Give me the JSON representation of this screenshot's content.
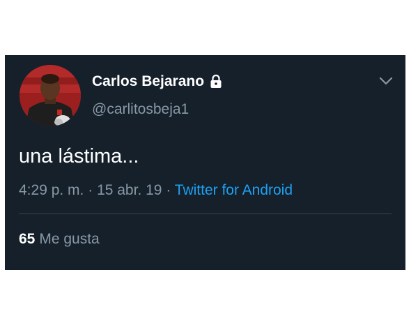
{
  "tweet": {
    "display_name": "Carlos Bejarano",
    "handle": "@carlitosbeja1",
    "text": "una lástima...",
    "time": "4:29 p. m.",
    "separator": "·",
    "date": "15 abr. 19",
    "source": "Twitter for Android",
    "likes_count": "65",
    "likes_label": "Me gusta",
    "protected": true
  },
  "icons": {
    "lock": "lock-icon",
    "chevron": "chevron-down-icon",
    "avatar": "avatar"
  },
  "colors": {
    "background": "#15202b",
    "text_primary": "#ffffff",
    "text_secondary": "#8899a6",
    "link": "#1da1f2",
    "divider": "#38444d"
  }
}
